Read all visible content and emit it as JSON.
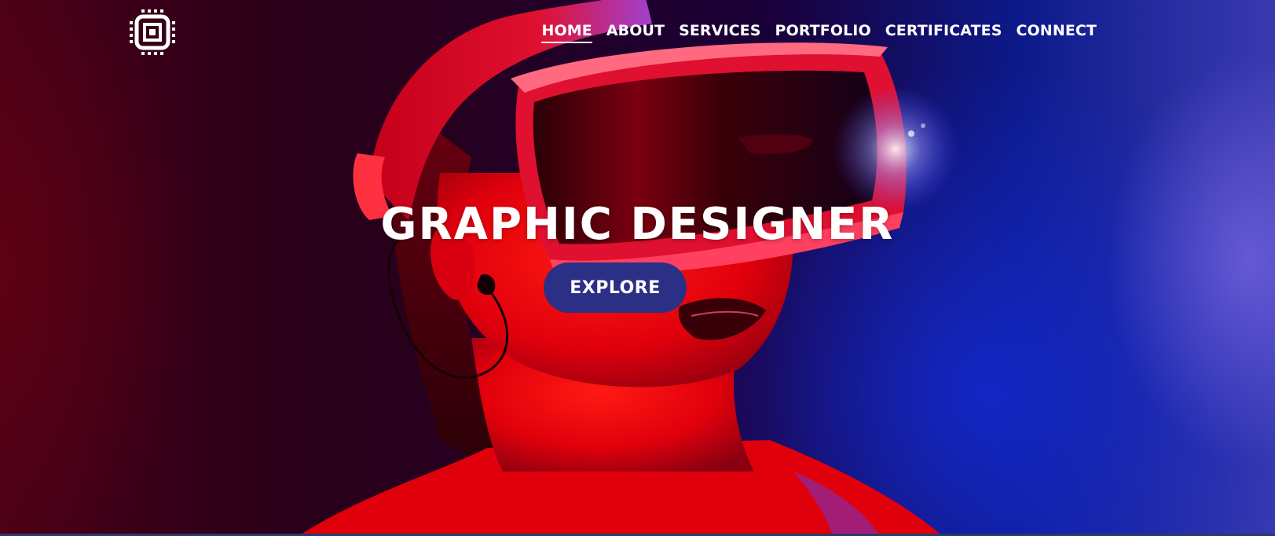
{
  "logo": {
    "icon": "cpu-chip-icon"
  },
  "nav": {
    "items": [
      {
        "label": "HOME",
        "active": true
      },
      {
        "label": "ABOUT",
        "active": false
      },
      {
        "label": "SERVICES",
        "active": false
      },
      {
        "label": "PORTFOLIO",
        "active": false
      },
      {
        "label": "CERTIFICATES",
        "active": false
      },
      {
        "label": "CONNECT",
        "active": false
      }
    ]
  },
  "hero": {
    "headline": "GRAPHIC DESIGNER",
    "cta_label": "EXPLORE",
    "cta_color": "#2c2f86",
    "image": "woman-wearing-vr-headset-photo"
  }
}
